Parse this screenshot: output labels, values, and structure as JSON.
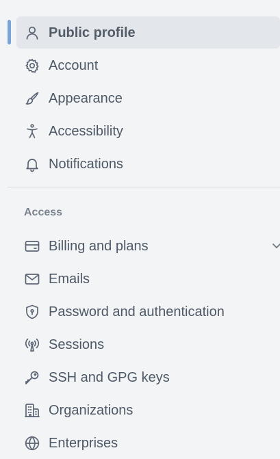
{
  "sidebar": {
    "items": [
      {
        "label": "Public profile",
        "icon": "person-icon",
        "active": true
      },
      {
        "label": "Account",
        "icon": "gear-icon"
      },
      {
        "label": "Appearance",
        "icon": "paintbrush-icon"
      },
      {
        "label": "Accessibility",
        "icon": "accessibility-icon"
      },
      {
        "label": "Notifications",
        "icon": "bell-icon"
      }
    ],
    "access_heading": "Access",
    "access_items": [
      {
        "label": "Billing and plans",
        "icon": "credit-card-icon",
        "expandable": true
      },
      {
        "label": "Emails",
        "icon": "mail-icon"
      },
      {
        "label": "Password and authentication",
        "icon": "shield-lock-icon"
      },
      {
        "label": "Sessions",
        "icon": "broadcast-icon"
      },
      {
        "label": "SSH and GPG keys",
        "icon": "key-icon"
      },
      {
        "label": "Organizations",
        "icon": "organization-icon"
      },
      {
        "label": "Enterprises",
        "icon": "globe-icon"
      }
    ]
  },
  "colors": {
    "background": "#f3f4f6",
    "active_background": "#e3e6ea",
    "active_indicator": "#7aa3d8",
    "text": "#4e5966"
  }
}
